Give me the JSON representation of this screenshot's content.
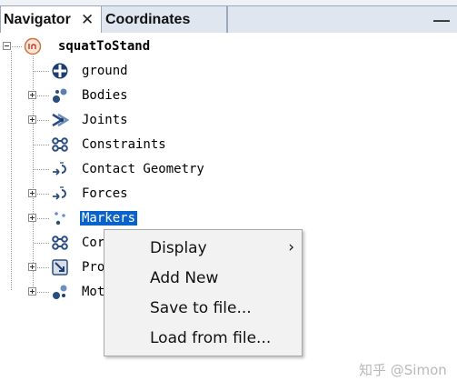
{
  "tabs": {
    "navigator_label": "Navigator",
    "close_glyph": "✕",
    "coordinates_label": "Coordinates",
    "minimize_glyph": "—"
  },
  "tree": {
    "root": {
      "label": "squatToStand",
      "icon": "model-icon",
      "expanded": true
    },
    "items": [
      {
        "label": "ground",
        "icon": "ground-icon",
        "expandable": false
      },
      {
        "label": "Bodies",
        "icon": "bodies-icon",
        "expandable": true
      },
      {
        "label": "Joints",
        "icon": "joints-icon",
        "expandable": true
      },
      {
        "label": "Constraints",
        "icon": "constraints-icon",
        "expandable": false
      },
      {
        "label": "Contact Geometry",
        "icon": "contact-geometry-icon",
        "expandable": false
      },
      {
        "label": "Forces",
        "icon": "forces-icon",
        "expandable": true
      },
      {
        "label": "Markers",
        "icon": "markers-icon",
        "expandable": true,
        "selected": true
      },
      {
        "label": "Cor",
        "icon": "controllers-icon",
        "expandable": false
      },
      {
        "label": "Pro",
        "icon": "probes-icon",
        "expandable": true
      },
      {
        "label": "Mot",
        "icon": "motions-icon",
        "expandable": true
      }
    ]
  },
  "context_menu": {
    "items": [
      {
        "label": "Display",
        "submenu": true
      },
      {
        "label": "Add New",
        "submenu": false
      },
      {
        "label": "Save to file...",
        "submenu": false
      },
      {
        "label": "Load from file...",
        "submenu": false
      }
    ]
  },
  "watermark": "知乎 @Simon",
  "colors": {
    "selection": "#0b63c9",
    "tab_bar": "#eef2f7",
    "menu_bg": "#f2f2f2"
  }
}
